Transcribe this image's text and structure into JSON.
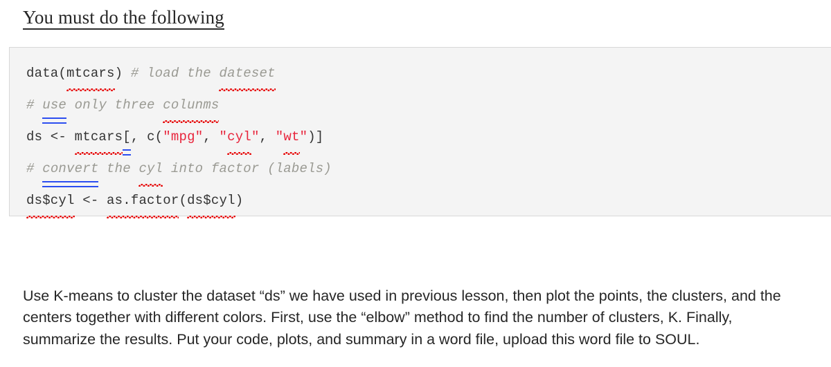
{
  "heading": {
    "text": "You must do the following"
  },
  "code_block": {
    "language": "r",
    "background_color": "#f4f4f4",
    "border_color": "#d8d8d8",
    "comment_color": "#9a9a93",
    "string_color": "#e8253c",
    "text_color": "#333333",
    "spellcheck_underline_color": "#e60000",
    "grammarcheck_underline_color": "#2b4df0",
    "lines": [
      {
        "plain_text": "data(mtcars) # load the dateset",
        "segments": [
          {
            "text": "data(",
            "type": "plain"
          },
          {
            "text": "mtcars",
            "type": "plain",
            "mark": "spell"
          },
          {
            "text": ") ",
            "type": "plain"
          },
          {
            "text": "# load the ",
            "type": "comment"
          },
          {
            "text": "dateset",
            "type": "comment",
            "mark": "spell"
          }
        ]
      },
      {
        "plain_text": "# use only three colunms",
        "segments": [
          {
            "text": "# ",
            "type": "comment"
          },
          {
            "text": "use",
            "type": "comment",
            "mark": "grammar"
          },
          {
            "text": " only three ",
            "type": "comment"
          },
          {
            "text": "colunms",
            "type": "comment",
            "mark": "spell"
          }
        ]
      },
      {
        "plain_text": "ds <- mtcars[, c(\"mpg\", \"cyl\", \"wt\")]",
        "segments": [
          {
            "text": "ds <- ",
            "type": "plain"
          },
          {
            "text": "mtcars",
            "type": "plain",
            "mark": "spell"
          },
          {
            "text": "[",
            "type": "plain",
            "mark": "grammar"
          },
          {
            "text": ", c(",
            "type": "plain"
          },
          {
            "text": "\"mpg\"",
            "type": "string"
          },
          {
            "text": ", ",
            "type": "plain"
          },
          {
            "text": "\"",
            "type": "string"
          },
          {
            "text": "cyl",
            "type": "string",
            "mark": "spell"
          },
          {
            "text": "\"",
            "type": "string"
          },
          {
            "text": ", ",
            "type": "plain"
          },
          {
            "text": "\"",
            "type": "string"
          },
          {
            "text": "wt",
            "type": "string",
            "mark": "spell"
          },
          {
            "text": "\"",
            "type": "string"
          },
          {
            "text": ")]",
            "type": "plain"
          }
        ]
      },
      {
        "plain_text": "# convert the cyl into factor (labels)",
        "segments": [
          {
            "text": "# ",
            "type": "comment"
          },
          {
            "text": "convert",
            "type": "comment",
            "mark": "grammar"
          },
          {
            "text": " the ",
            "type": "comment"
          },
          {
            "text": "cyl",
            "type": "comment",
            "mark": "spell"
          },
          {
            "text": " into factor (labels)",
            "type": "comment"
          }
        ]
      },
      {
        "plain_text": "ds$cyl <- as.factor(ds$cyl)",
        "segments": [
          {
            "text": "ds$cyl",
            "type": "plain",
            "mark": "spell"
          },
          {
            "text": " <- ",
            "type": "plain"
          },
          {
            "text": "as.factor",
            "type": "plain",
            "mark": "spell"
          },
          {
            "text": "(",
            "type": "plain"
          },
          {
            "text": "ds$cyl",
            "type": "plain",
            "mark": "spell"
          },
          {
            "text": ")",
            "type": "plain"
          }
        ]
      }
    ]
  },
  "instructions": {
    "paragraph": "Use K-means to cluster the dataset “ds” we have used in previous lesson, then plot the points, the clusters, and the centers together with different colors. First, use the “elbow” method to find the number of clusters, K. Finally, summarize the results. Put your code, plots, and summary in a word file, upload this word file to SOUL."
  }
}
